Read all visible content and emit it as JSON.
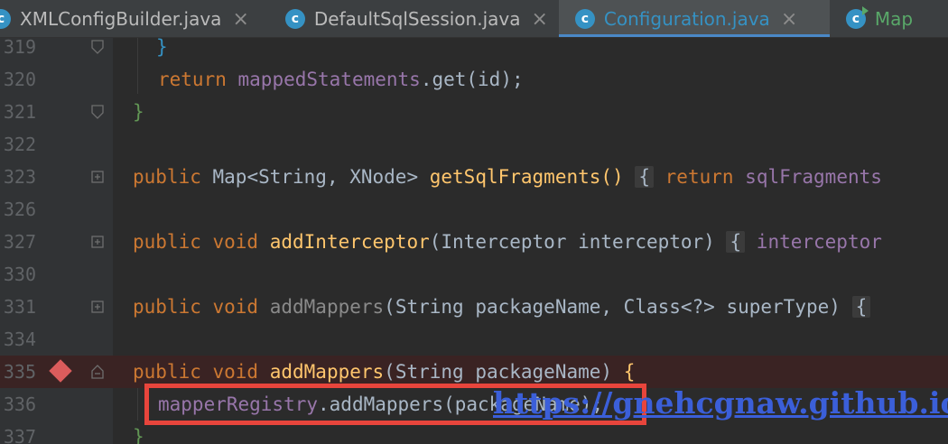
{
  "tabs": [
    {
      "label": "XMLConfigBuilder.java",
      "icon": "class-icon"
    },
    {
      "label": "DefaultSqlSession.java",
      "icon": "class-icon"
    },
    {
      "label": "Configuration.java",
      "icon": "class-icon",
      "active": true
    },
    {
      "label": "Map",
      "icon": "class-run-icon"
    }
  ],
  "tab_icon_letter": "c",
  "close_glyph": "×",
  "line_numbers": [
    "319",
    "320",
    "321",
    "322",
    "323",
    "326",
    "327",
    "330",
    "331",
    "334",
    "335",
    "336",
    "337"
  ],
  "code": {
    "l319": "}",
    "l320_kw": "return",
    "l320_field": "mappedStatements",
    "l320_rest": ".get(id);",
    "l321": "}",
    "l323_kw": "public",
    "l323_type": "Map<String, XNode>",
    "l323_method": "getSqlFragments()",
    "l323_fold": "{",
    "l323_kw2": "return",
    "l323_field": "sqlFragments",
    "l327_kw": "public void",
    "l327_method": "addInterceptor",
    "l327_params": "(Interceptor interceptor)",
    "l327_fold": "{",
    "l327_field": "interceptor",
    "l331_kw": "public void",
    "l331_method": "addMappers",
    "l331_params": "(String packageName, Class<?> superType)",
    "l331_fold": "{",
    "l335_kw": "public void",
    "l335_method": "addMappers",
    "l335_params": "(String packageName)",
    "l335_brace": "{",
    "l336_field": "mapperRegistry",
    "l336_rest": ".addMappers(packageName);",
    "l337": "}"
  },
  "watermark": "https://gnehcgnaw.github.io/",
  "colors": {
    "background": "#2b2b2b",
    "keyword": "#cc7832",
    "field": "#9876aa",
    "method": "#ffc66d",
    "breakpoint": "#db5c5c",
    "highlight_box": "#e8453c",
    "active_tab_text": "#3592c4"
  }
}
